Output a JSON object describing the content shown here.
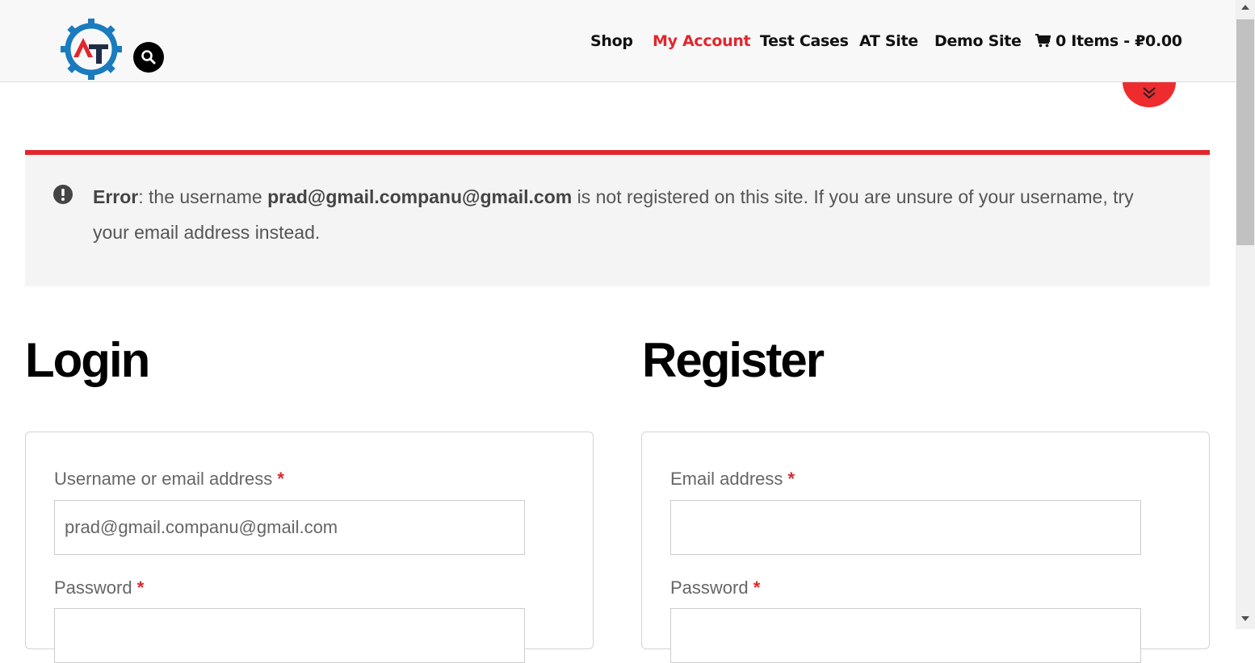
{
  "header": {
    "logo_alt": "AT",
    "nav": [
      {
        "label": "Shop",
        "active": false
      },
      {
        "label": "My Account",
        "active": true
      },
      {
        "label": "Test Cases",
        "active": false
      },
      {
        "label": "AT Site",
        "active": false
      },
      {
        "label": "Demo Site",
        "active": false
      }
    ],
    "cart_label": "0 Items - ",
    "cart_total": "₽0.00",
    "accent_color": "#e1262d"
  },
  "error": {
    "prefix": "Error",
    "sep": ": the username ",
    "username": "prad@gmail.companu@gmail.com",
    "suffix": " is not registered on this site. If you are unsure of your username, try your email address instead."
  },
  "login": {
    "title": "Login",
    "username_label": "Username or email address",
    "username_value": "prad@gmail.companu@gmail.com",
    "password_label": "Password",
    "required_mark": "*"
  },
  "register": {
    "title": "Register",
    "email_label": "Email address",
    "email_value": "",
    "password_label": "Password",
    "required_mark": "*"
  }
}
